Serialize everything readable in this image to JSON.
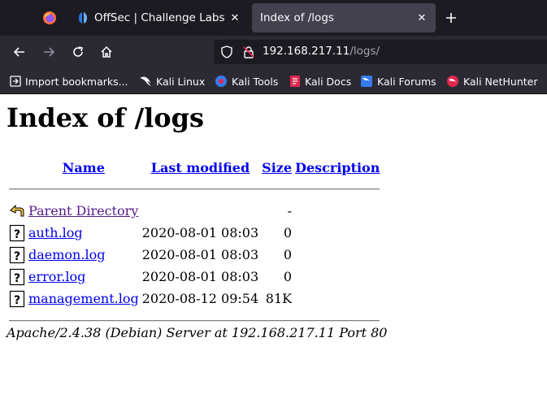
{
  "browser": {
    "tabs": [
      {
        "label": "OffSec | Challenge Labs",
        "active": false
      },
      {
        "label": "Index of /logs",
        "active": true
      }
    ],
    "url": {
      "host": "192.168.217.11",
      "path": "/logs/"
    },
    "bookmarks": [
      {
        "label": "Import bookmarks...",
        "icon": "import-icon"
      },
      {
        "label": "Kali Linux",
        "icon": "kali-dragon-icon"
      },
      {
        "label": "Kali Tools",
        "icon": "kali-tools-icon"
      },
      {
        "label": "Kali Docs",
        "icon": "kali-docs-icon"
      },
      {
        "label": "Kali Forums",
        "icon": "kali-forums-icon"
      },
      {
        "label": "Kali NetHunter",
        "icon": "kali-nethunter-icon"
      }
    ],
    "colors": {
      "tabbar": "#1c1b22",
      "toolbar": "#2b2a33",
      "active_tab": "#42414d"
    }
  },
  "page": {
    "title": "Index of /logs",
    "columns": {
      "name": "Name",
      "last_modified": "Last modified",
      "size": "Size",
      "description": "Description"
    },
    "parent": {
      "name": "Parent Directory",
      "modified": "",
      "size": "-"
    },
    "files": [
      {
        "name": "auth.log",
        "modified": "2020-08-01 08:03",
        "size": "0"
      },
      {
        "name": "daemon.log",
        "modified": "2020-08-01 08:03",
        "size": "0"
      },
      {
        "name": "error.log",
        "modified": "2020-08-01 08:03",
        "size": "0"
      },
      {
        "name": "management.log",
        "modified": "2020-08-12 09:54",
        "size": "81K"
      }
    ],
    "footer": "Apache/2.4.38 (Debian) Server at 192.168.217.11 Port 80",
    "colors": {
      "link": "#0000ee",
      "visited": "#551a8b"
    }
  }
}
